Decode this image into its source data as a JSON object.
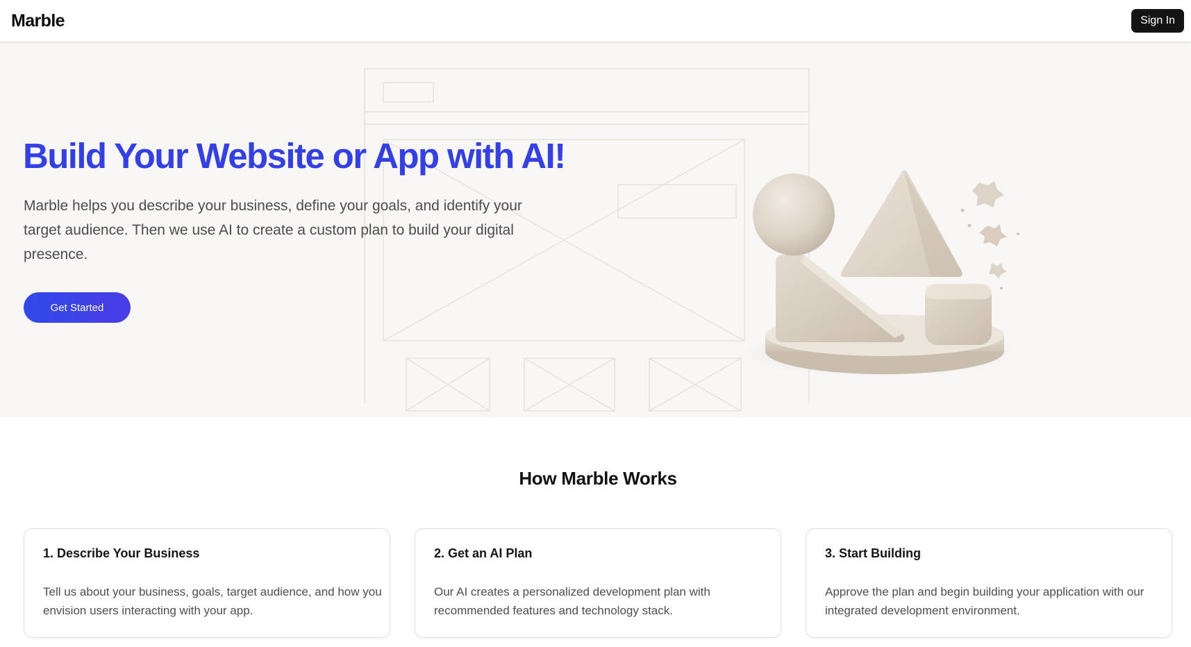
{
  "header": {
    "logo": "Marble",
    "signin_label": "Sign In"
  },
  "hero": {
    "title": "Build Your Website or App with AI!",
    "description": "Marble helps you describe your business, define your goals, and identify your target audience. Then we use AI to create a custom plan to build your digital presence.",
    "cta_label": "Get Started",
    "accent_color": "#3340e6",
    "background_color": "#f8f7f5"
  },
  "how": {
    "title": "How Marble Works",
    "cards": [
      {
        "title": "1. Describe Your Business",
        "description": "Tell us about your business, goals, target audience, and how you envision users interacting with your app."
      },
      {
        "title": "2. Get an AI Plan",
        "description": "Our AI creates a personalized development plan with recommended features and technology stack."
      },
      {
        "title": "3. Start Building",
        "description": "Approve the plan and begin building your application with our integrated development environment."
      }
    ]
  }
}
